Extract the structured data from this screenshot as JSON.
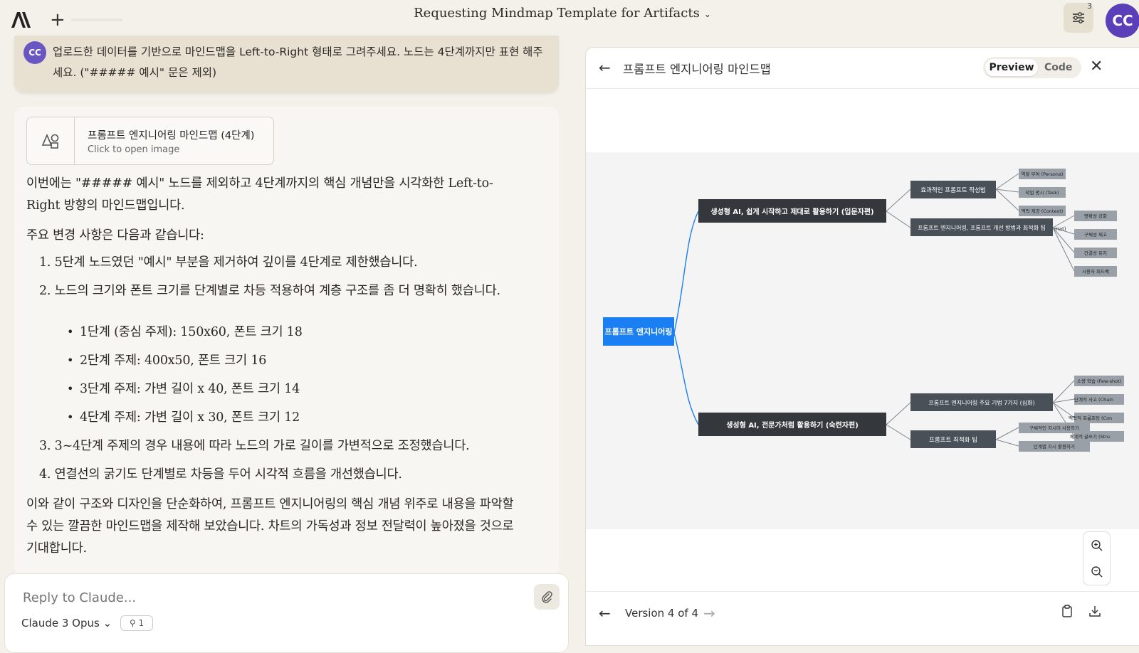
{
  "header": {
    "title": "Requesting Mindmap Template for Artifacts",
    "settings_badge": "3",
    "avatar_initials": "CC"
  },
  "user_message": {
    "avatar_initials": "CC",
    "text": "업로드한 데이터를 기반으로 마인드맵을 Left-to-Right 형태로 그려주세요. 노드는 4단계까지만 표현 해주세요. (\"##### 예시\" 문은 제외)"
  },
  "artifact_card": {
    "title": "프롬프트 엔지니어링 마인드맵 (4단계)",
    "subtitle": "Click to open image"
  },
  "assistant": {
    "intro": "이번에는 \"##### 예시\" 노드를 제외하고 4단계까지의 핵심 개념만을 시각화한 Left-to-Right 방향의 마인드맵입니다.",
    "changes_heading": "주요 변경 사항은 다음과 같습니다:",
    "items": [
      "1. 5단계 노드였던 \"예시\" 부분을 제거하여 깊이를 4단계로 제한했습니다.",
      "2. 노드의 크기와 폰트 크기를 단계별로 차등 적용하여 계층 구조를 좀 더 명확히 했습니다.",
      "3. 3~4단계 주제의 경우 내용에 따라 노드의 가로 길이를 가변적으로 조정했습니다.",
      "4. 연결선의 굵기도 단계별로 차등을 두어 시각적 흐름을 개선했습니다."
    ],
    "sub_items": [
      "1단계 (중심 주제): 150x60, 폰트 크기 18",
      "2단계 주제: 400x50, 폰트 크기 16",
      "3단계 주제: 가변 길이 x 40, 폰트 크기 14",
      "4단계 주제: 가변 길이 x 30, 폰트 크기 12"
    ],
    "conclusion": "이와 같이 구조와 디자인을 단순화하여, 프롬프트 엔지니어링의 핵심 개념 위주로 내용을 파악할 수 있는 깔끔한 마인드맵을 제작해 보았습니다. 차트의 가독성과 정보 전달력이 높아졌을 것으로 기대합니다."
  },
  "reply": {
    "placeholder": "Reply to Claude...",
    "model": "Claude 3 Opus",
    "chip": "1"
  },
  "panel": {
    "title": "프롬프트 엔지니어링 마인드맵",
    "preview_label": "Preview",
    "code_label": "Code",
    "version": "Version 4 of 4"
  },
  "mindmap": {
    "root": "프롬프트 엔지니어링",
    "level2": [
      "생성형 AI, 쉽게 시작하고 제대로 활용하기 (입문자편)",
      "생성형 AI, 전문가처럼 활용하기 (숙련자편)"
    ],
    "level3": [
      "효과적인 프롬프트 작성법",
      "프롬프트 엔지니어링, 프롬프트 개선 방법과 최적화 팁",
      "프롬프트 엔지니어링 주요 기법 7가지 (심화)",
      "프롬프트 최적화 팁"
    ],
    "level4_a": [
      "역할 부여 (Persona)",
      "작업 명시 (Task)",
      "맥락 제공 (Context)"
    ],
    "level4_b": [
      "명확성 강화",
      "구체성 제고",
      "간결성 유지",
      "사용자 피드백"
    ],
    "level4_c": [
      "소량 학습 (Few-shot)",
      "단계적 사고 (Chain",
      "맥락적 프롬프팅 (Con",
      "체계적 글쓰기 (Stru"
    ],
    "level4_d": [
      "구체적인 지시어 사용하기",
      "단계별 지시 활용하기"
    ],
    "stray_label": "mat)",
    "colors": {
      "root": "#1a7ff2",
      "level2": "#34383d",
      "level3": "#4a5058",
      "level4": "#9aa0a8",
      "edge": "#1a7ff2"
    }
  }
}
